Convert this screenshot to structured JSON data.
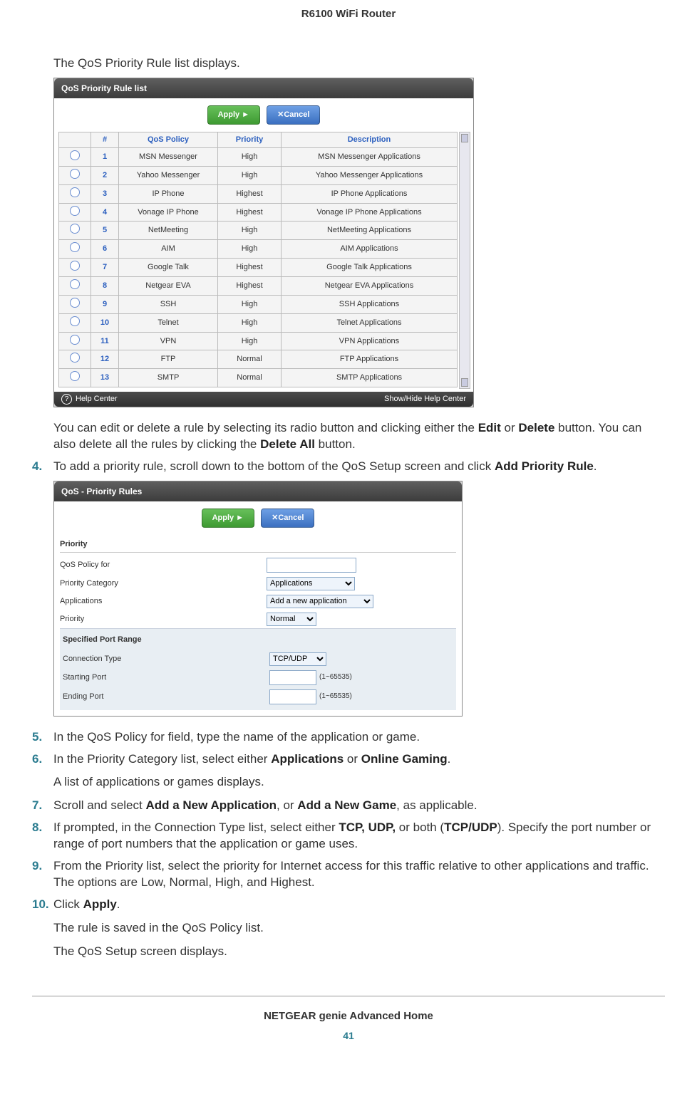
{
  "header": {
    "title": "R6100 WiFi Router"
  },
  "intro_text": "The QoS Priority Rule list displays.",
  "after_list_text": "You can edit or delete a rule by selecting its radio button and clicking either the Edit or Delete button. You can also delete all the rules by clicking the Delete All button.",
  "scr1": {
    "title": "QoS Priority Rule list",
    "apply": "Apply ►",
    "cancel": "✕Cancel",
    "headers": {
      "sel": "",
      "num": "#",
      "policy": "QoS Policy",
      "priority": "Priority",
      "desc": "Description"
    },
    "rows": [
      {
        "n": "1",
        "policy": "MSN Messenger",
        "pri": "High",
        "desc": "MSN Messenger Applications"
      },
      {
        "n": "2",
        "policy": "Yahoo Messenger",
        "pri": "High",
        "desc": "Yahoo Messenger Applications"
      },
      {
        "n": "3",
        "policy": "IP Phone",
        "pri": "Highest",
        "desc": "IP Phone Applications"
      },
      {
        "n": "4",
        "policy": "Vonage IP Phone",
        "pri": "Highest",
        "desc": "Vonage IP Phone Applications"
      },
      {
        "n": "5",
        "policy": "NetMeeting",
        "pri": "High",
        "desc": "NetMeeting Applications"
      },
      {
        "n": "6",
        "policy": "AIM",
        "pri": "High",
        "desc": "AIM Applications"
      },
      {
        "n": "7",
        "policy": "Google Talk",
        "pri": "Highest",
        "desc": "Google Talk Applications"
      },
      {
        "n": "8",
        "policy": "Netgear EVA",
        "pri": "Highest",
        "desc": "Netgear EVA Applications"
      },
      {
        "n": "9",
        "policy": "SSH",
        "pri": "High",
        "desc": "SSH Applications"
      },
      {
        "n": "10",
        "policy": "Telnet",
        "pri": "High",
        "desc": "Telnet Applications"
      },
      {
        "n": "11",
        "policy": "VPN",
        "pri": "High",
        "desc": "VPN Applications"
      },
      {
        "n": "12",
        "policy": "FTP",
        "pri": "Normal",
        "desc": "FTP Applications"
      },
      {
        "n": "13",
        "policy": "SMTP",
        "pri": "Normal",
        "desc": "SMTP Applications"
      }
    ],
    "help_label": "Help Center",
    "show_hide": "Show/Hide Help Center"
  },
  "steps": {
    "s4": {
      "num": "4.",
      "text": "To add a priority rule, scroll down to the bottom of the QoS Setup screen and click ",
      "bold": "Add Priority Rule",
      "tail": "."
    },
    "s5": {
      "num": "5.",
      "text": "In the QoS Policy for field, type the name of the application or game."
    },
    "s6": {
      "num": "6.",
      "pre": "In the Priority Category list, select either ",
      "b1": "Applications",
      "mid": " or ",
      "b2": "Online Gaming",
      "tail": "."
    },
    "s6_after": "A list of applications or games displays.",
    "s7": {
      "num": "7.",
      "pre": "Scroll and select ",
      "b1": "Add a New Application",
      "mid": ", or ",
      "b2": "Add a New Game",
      "tail": ", as applicable."
    },
    "s8": {
      "num": "8.",
      "pre": "If prompted, in the Connection Type list, select either ",
      "b1": "TCP, UDP,",
      "mid": " or both (",
      "b2": "TCP/UDP",
      "tail": "). Specify the port number or range of port numbers that the application or game uses."
    },
    "s9": {
      "num": "9.",
      "text": "From the Priority list, select the priority for Internet access for this traffic relative to other applications and traffic. The options are Low, Normal, High, and Highest."
    },
    "s10": {
      "num": "10.",
      "pre": "Click ",
      "b1": "Apply",
      "tail": "."
    },
    "s10_after1": "The rule is saved in the QoS Policy list.",
    "s10_after2": "The QoS Setup screen displays."
  },
  "scr2": {
    "title": "QoS - Priority Rules",
    "apply": "Apply ►",
    "cancel": "✕Cancel",
    "section_priority": "Priority",
    "lbl_policy_for": "QoS Policy for",
    "lbl_pri_cat": "Priority Category",
    "sel_pri_cat": "Applications",
    "lbl_apps": "Applications",
    "sel_apps": "Add a new application",
    "lbl_priority": "Priority",
    "sel_priority": "Normal",
    "section_port": "Specified Port Range",
    "lbl_conn": "Connection Type",
    "sel_conn": "TCP/UDP",
    "lbl_start": "Starting Port",
    "lbl_end": "Ending Port",
    "hint": "(1~65535)"
  },
  "footer": {
    "title": "NETGEAR genie Advanced Home",
    "page": "41"
  }
}
